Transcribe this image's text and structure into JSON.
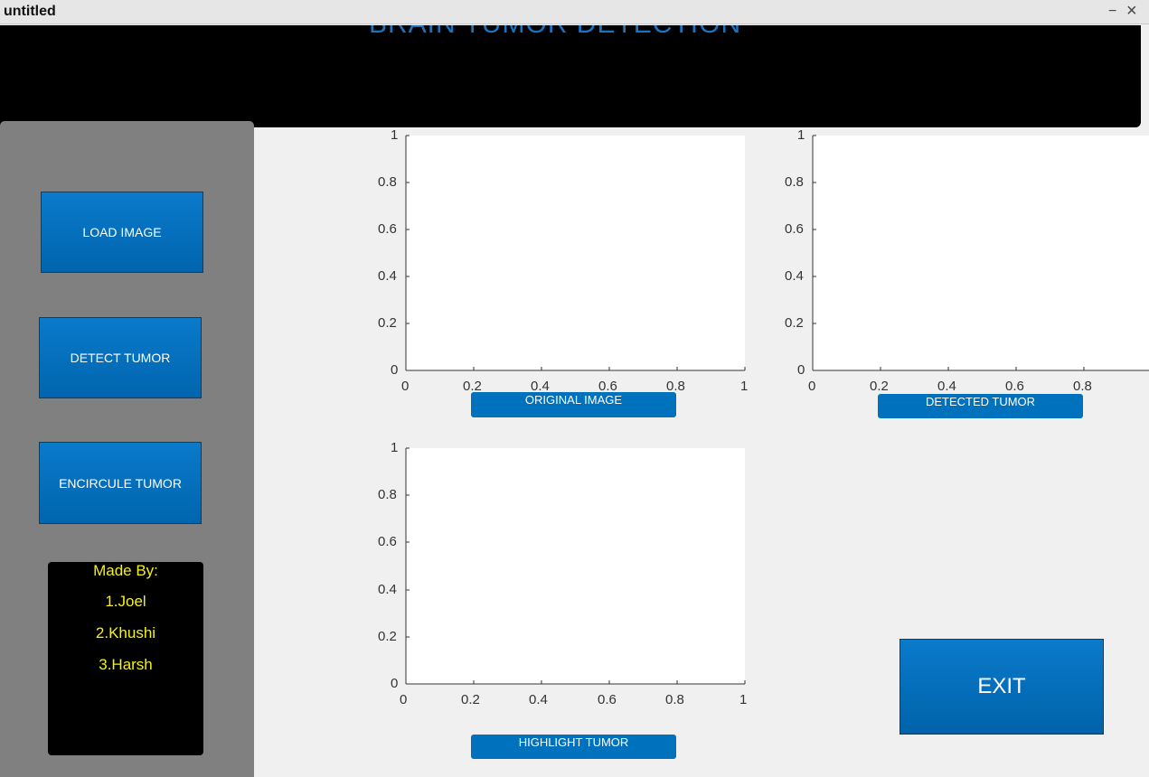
{
  "window": {
    "title": "untitled",
    "minimize_glyph": "−",
    "close_glyph": "×"
  },
  "header": {
    "title": "BRAIN TUMOR DETECTION"
  },
  "sidebar": {
    "buttons": [
      "LOAD IMAGE",
      "DETECT TUMOR",
      "ENCIRCULE TUMOR"
    ],
    "credits": {
      "heading": "Made By:",
      "names": [
        "1.Joel",
        "2.Khushi",
        "3.Harsh"
      ]
    }
  },
  "axes": {
    "ticks": [
      "0",
      "0.2",
      "0.4",
      "0.6",
      "0.8",
      "1"
    ],
    "original": {
      "label": "ORIGINAL IMAGE"
    },
    "detected": {
      "label": "DETECTED TUMOR"
    },
    "highlight": {
      "label": "HIGHLIGHT TUMOR"
    }
  },
  "exit_label": "EXIT",
  "colors": {
    "accent": "#0072bd",
    "header_bg": "#000000",
    "sidebar_bg": "#808080",
    "credits_text": "#f4f01a",
    "background": "#f0f0f0"
  }
}
